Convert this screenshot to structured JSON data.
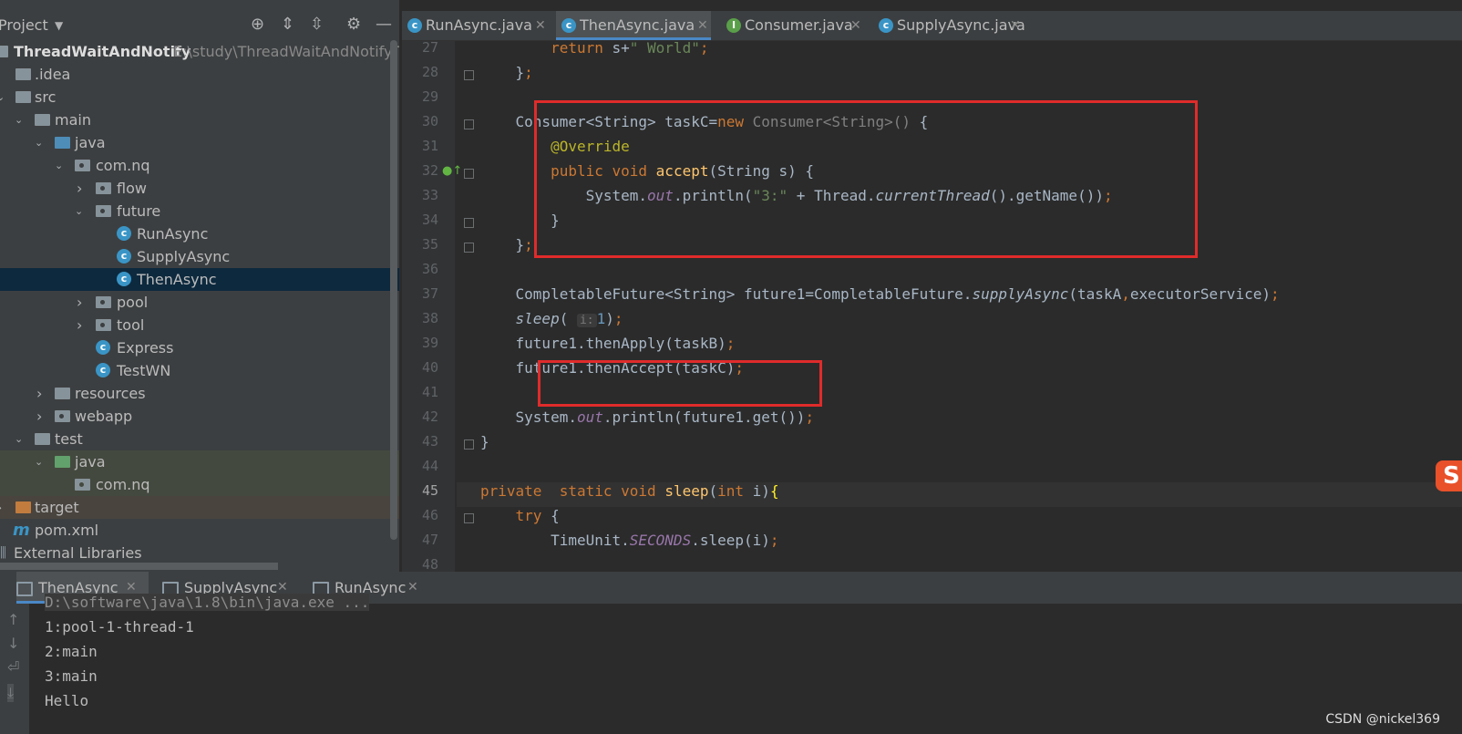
{
  "project_panel": {
    "title": "Project",
    "root": {
      "name": "ThreadWaitAndNotify",
      "path": "E:\\study\\ThreadWaitAndNotify\\Thr"
    },
    "items": [
      {
        "label": ".idea"
      },
      {
        "label": "src"
      },
      {
        "label": "main"
      },
      {
        "label": "java"
      },
      {
        "label": "com.nq"
      },
      {
        "label": "flow"
      },
      {
        "label": "future"
      },
      {
        "label": "RunAsync"
      },
      {
        "label": "SupplyAsync"
      },
      {
        "label": "ThenAsync"
      },
      {
        "label": "pool"
      },
      {
        "label": "tool"
      },
      {
        "label": "Express"
      },
      {
        "label": "TestWN"
      },
      {
        "label": "resources"
      },
      {
        "label": "webapp"
      },
      {
        "label": "test"
      },
      {
        "label": "java"
      },
      {
        "label": "com.nq"
      },
      {
        "label": "target"
      },
      {
        "label": "pom.xml"
      },
      {
        "label": "External Libraries"
      }
    ]
  },
  "editor": {
    "tabs": [
      {
        "label": "RunAsync.java",
        "icon": "class-icon"
      },
      {
        "label": "ThenAsync.java",
        "icon": "class-icon",
        "active": true
      },
      {
        "label": "Consumer.java",
        "icon": "interface-icon"
      },
      {
        "label": "SupplyAsync.java",
        "icon": "class-icon"
      }
    ],
    "line_numbers": [
      "27",
      "28",
      "29",
      "30",
      "31",
      "32",
      "33",
      "34",
      "35",
      "36",
      "37",
      "38",
      "39",
      "40",
      "41",
      "42",
      "43",
      "44",
      "45",
      "46",
      "47",
      "48"
    ],
    "current_line": "45",
    "hint_label": "i:"
  },
  "run_panel": {
    "tabs": [
      {
        "label": "ThenAsync",
        "active": true
      },
      {
        "label": "SupplyAsync"
      },
      {
        "label": "RunAsync"
      }
    ],
    "command": "D:\\software\\java\\1.8\\bin\\java.exe ...",
    "output": [
      "1:pool-1-thread-1",
      "2:main",
      "3:main",
      "Hello"
    ]
  },
  "watermark": "CSDN @nickel369",
  "colors": {
    "highlight_box": "#e02b2b",
    "accent": "#4a88c7",
    "selection": "#0d293e"
  }
}
